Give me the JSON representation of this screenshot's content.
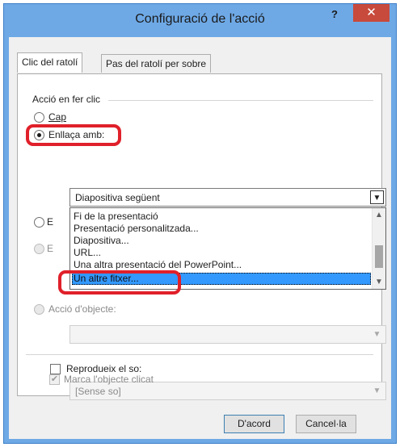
{
  "window": {
    "title": "Configuració de l'acció",
    "help_label": "?",
    "close_label": "✕"
  },
  "tabs": [
    {
      "label": "Clic del ratolí",
      "active": true
    },
    {
      "label": "Pas del ratolí per sobre",
      "active": false
    }
  ],
  "action_group": {
    "label": "Acció en fer clic",
    "options": {
      "none": {
        "label": "Cap",
        "checked": false
      },
      "link": {
        "label": "Enllaça amb:",
        "checked": true
      },
      "object_action": {
        "label": "Acció d'objecte:"
      }
    }
  },
  "link_combo": {
    "value": "Diapositiva següent",
    "arrow": "▼"
  },
  "link_dropdown": {
    "items": [
      "Fi de la presentació",
      "Presentació personalitzada...",
      "Diapositiva...",
      "URL...",
      "Una altra presentació del PowerPoint...",
      "Un altre fitxer..."
    ],
    "selected_index": 5,
    "scroll_up": "▲",
    "scroll_down": "▼"
  },
  "hidden_option_prefixes": [
    "E",
    "E"
  ],
  "object_combo": {
    "value": "",
    "arrow": "▼"
  },
  "sound": {
    "label": "Reprodueix el so:",
    "checked": false,
    "combo_value": "[Sense so]",
    "arrow": "▼"
  },
  "highlight": {
    "label": "Marca l'objecte clicat",
    "checked": true,
    "check_glyph": "✔"
  },
  "buttons": {
    "ok": "D'acord",
    "cancel": "Cancel·la"
  },
  "colors": {
    "title_bar": "#6ea9e6",
    "close_button": "#c84a3c",
    "selection": "#3399ff",
    "annotation": "#e0202a"
  }
}
